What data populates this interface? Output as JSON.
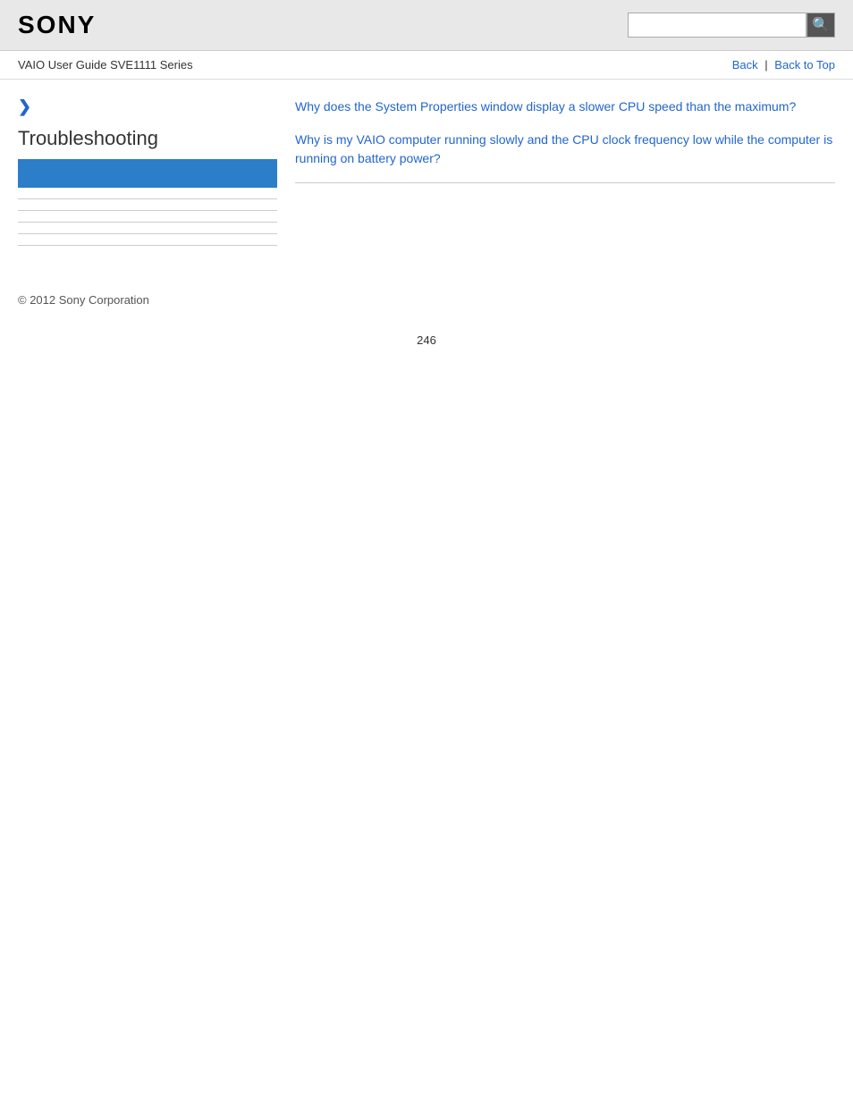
{
  "header": {
    "logo": "SONY",
    "search_placeholder": "",
    "search_button_icon": "🔍"
  },
  "nav": {
    "guide_title": "VAIO User Guide SVE1111 Series",
    "back_label": "Back",
    "separator": "|",
    "back_to_top_label": "Back to Top"
  },
  "sidebar": {
    "chevron": "❯",
    "section_title": "Troubleshooting",
    "dividers": 5
  },
  "content": {
    "links": [
      {
        "text": "Why does the System Properties window display a slower CPU speed than the maximum?"
      },
      {
        "text": "Why is my VAIO computer running slowly and the CPU clock frequency low while the computer is running on battery power?"
      }
    ]
  },
  "footer": {
    "copyright": "© 2012 Sony Corporation"
  },
  "page_number": "246"
}
